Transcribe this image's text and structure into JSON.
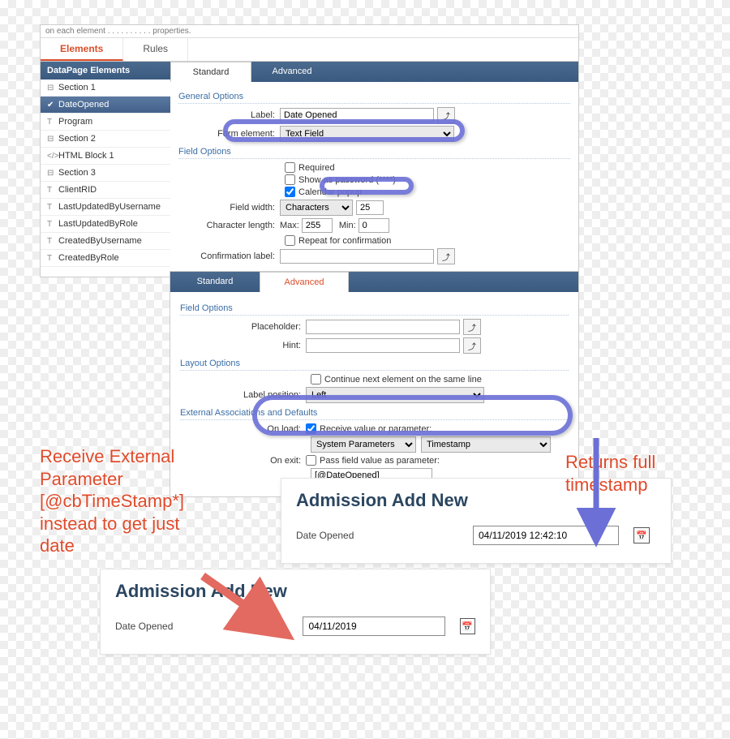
{
  "frag_text": "on each element . . . . . . . . . . properties.",
  "top_tabs": {
    "elements": "Elements",
    "rules": "Rules"
  },
  "sidebar": {
    "header": "DataPage Elements",
    "items": [
      {
        "glyph": "⊟",
        "label": "Section 1"
      },
      {
        "glyph": "✔",
        "label": "DateOpened"
      },
      {
        "glyph": "T",
        "label": "Program"
      },
      {
        "glyph": "⊟",
        "label": "Section 2"
      },
      {
        "glyph": "</>",
        "label": "HTML Block 1"
      },
      {
        "glyph": "⊟",
        "label": "Section 3"
      },
      {
        "glyph": "T",
        "label": "ClientRID"
      },
      {
        "glyph": "T",
        "label": "LastUpdatedByUsername"
      },
      {
        "glyph": "T",
        "label": "LastUpdatedByRole"
      },
      {
        "glyph": "T",
        "label": "CreatedByUsername"
      },
      {
        "glyph": "T",
        "label": "CreatedByRole"
      }
    ]
  },
  "cfg_tabs": {
    "standard": "Standard",
    "advanced": "Advanced"
  },
  "general": {
    "title": "General Options",
    "label_lbl": "Label:",
    "label_val": "Date Opened",
    "form_element_lbl": "Form element:",
    "form_element_val": "Text Field"
  },
  "field": {
    "title": "Field Options",
    "required": "Required",
    "show_as_pw": "Show as password (****)",
    "calendar": "Calendar popup",
    "field_width_lbl": "Field width:",
    "field_width_unit": "Characters",
    "field_width_val": "25",
    "charlen_lbl": "Character length:",
    "charlen_max_lbl": "Max:",
    "charlen_max_val": "255",
    "charlen_min_lbl": "Min:",
    "charlen_min_val": "0",
    "repeat": "Repeat for confirmation",
    "conf_label_lbl": "Confirmation label:",
    "conf_label_val": ""
  },
  "adv": {
    "field_title": "Field Options",
    "placeholder_lbl": "Placeholder:",
    "hint_lbl": "Hint:",
    "layout_title": "Layout Options",
    "continue_same_line": "Continue next element on the same line",
    "label_pos_lbl": "Label position:",
    "label_pos_val": "Left",
    "ext_title": "External Associations and Defaults",
    "onload_lbl": "On load:",
    "onload_chk": "Receive value or parameter:",
    "src_select": "System Parameters",
    "param_select": "Timestamp",
    "onexit_lbl": "On exit:",
    "onexit_chk": "Pass field value as parameter:",
    "onexit_param": "[@DateOpened]"
  },
  "preview1": {
    "title": "Admission Add New",
    "lbl": "Date Opened",
    "val": "04/11/2019 12:42:10"
  },
  "preview2": {
    "title": "Admission Add New",
    "lbl": "Date Opened",
    "val": "04/11/2019"
  },
  "anno": {
    "right": "Returns full timestamp",
    "left1": "Receive External",
    "left2": "Parameter",
    "left3": "[@cbTimeStamp*]",
    "left4": "instead to get just",
    "left5": "date"
  },
  "icons": {
    "insert": "⤴"
  }
}
